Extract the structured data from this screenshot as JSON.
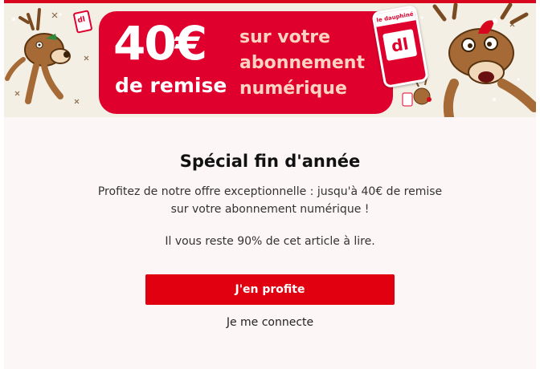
{
  "banner": {
    "amount": "40€",
    "subline": "de remise",
    "promo_lines": [
      "sur votre",
      "abonnement",
      "numérique"
    ],
    "phone_header": "le dauphiné",
    "phone_logo": "dl",
    "mini_logo": "dl",
    "colors": {
      "promo_red": "#e0002d",
      "promo_text_pink": "#ffd3c2",
      "banner_bg": "#f4efe5"
    }
  },
  "paywall": {
    "title": "Spécial fin d'année",
    "offer_line_1": "Profitez de notre offre exceptionnelle : jusqu'à 40€ de remise",
    "offer_line_2": "sur votre abonnement numérique !",
    "remaining_text": "Il vous reste 90% de cet article à lire.",
    "cta_label": "J'en profite",
    "login_label": "Je me connecte",
    "colors": {
      "cta": "#e0000f",
      "card_bg": "#fdf6f6"
    }
  }
}
